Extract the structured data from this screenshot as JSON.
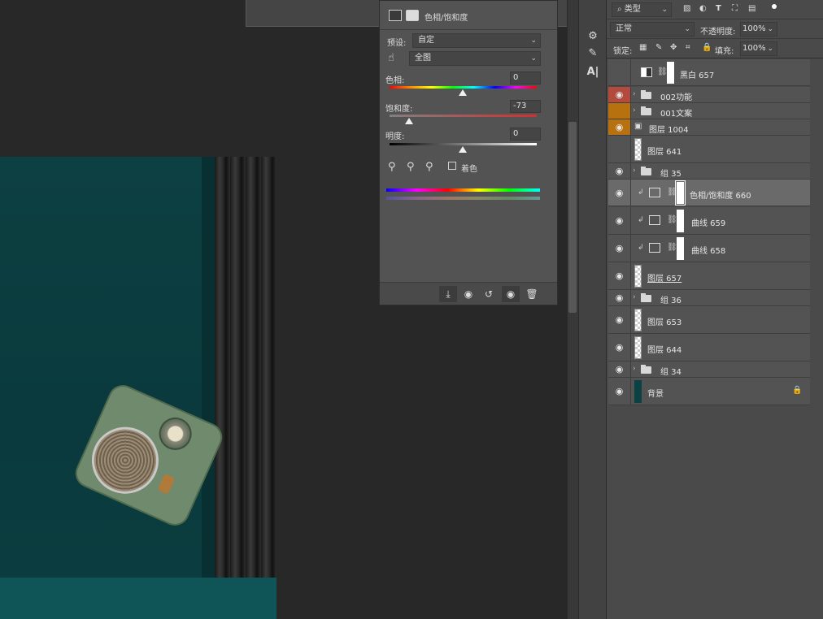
{
  "properties": {
    "title": "色相/饱和度",
    "preset_label": "预设:",
    "preset_value": "自定",
    "channel_value": "全图",
    "hue_label": "色相:",
    "hue_value": "0",
    "saturation_label": "饱和度:",
    "saturation_value": "-73",
    "lightness_label": "明度:",
    "lightness_value": "0",
    "colorize_label": "着色",
    "colors": {
      "panel": "#535353",
      "field": "#454545"
    }
  },
  "layers_toolbar": {
    "filter_label": "类型",
    "blend_mode": "正常",
    "opacity_label": "不透明度:",
    "opacity_value": "100%",
    "lock_label": "锁定:",
    "fill_label": "填充:",
    "fill_value": "100%"
  },
  "layers": [
    {
      "name": "黑白 657"
    },
    {
      "name": "002功能"
    },
    {
      "name": "001文案"
    },
    {
      "name": "图层 1004"
    },
    {
      "name": "图层 641"
    },
    {
      "name": "组 35"
    },
    {
      "name": "色相/饱和度 660"
    },
    {
      "name": "曲线 659"
    },
    {
      "name": "曲线 658"
    },
    {
      "name": "图层 657"
    },
    {
      "name": "组 36"
    },
    {
      "name": "图层 653"
    },
    {
      "name": "图层 644"
    },
    {
      "name": "组 34"
    },
    {
      "name": "背景"
    }
  ]
}
